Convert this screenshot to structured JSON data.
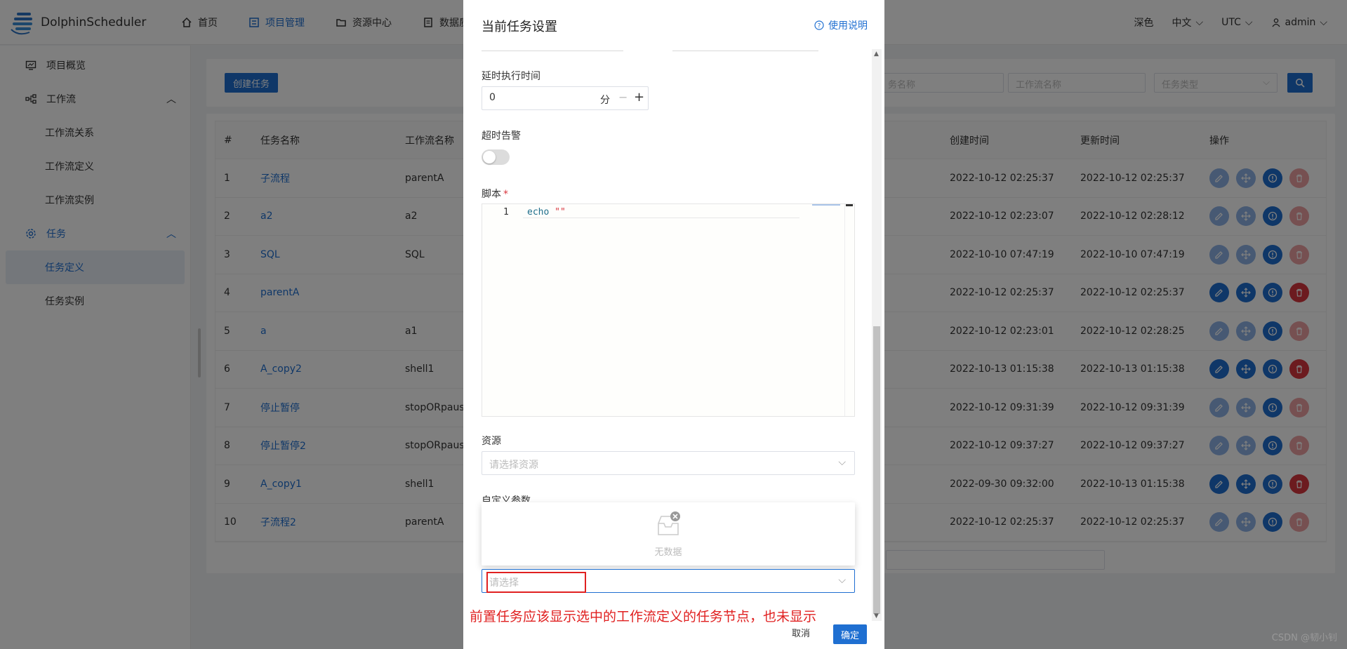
{
  "header": {
    "app_name": "DolphinScheduler",
    "nav": [
      {
        "label": "首页",
        "icon": "home-icon"
      },
      {
        "label": "项目管理",
        "icon": "project-icon"
      },
      {
        "label": "资源中心",
        "icon": "folder-icon"
      },
      {
        "label": "数据质量",
        "icon": "document-icon"
      }
    ],
    "theme": "深色",
    "language": "中文",
    "timezone": "UTC",
    "user": "admin"
  },
  "sidebar": {
    "items": [
      {
        "label": "项目概览",
        "icon": "monitor-icon"
      },
      {
        "label": "工作流",
        "icon": "workflow-icon"
      },
      {
        "label": "工作流关系"
      },
      {
        "label": "工作流定义"
      },
      {
        "label": "工作流实例"
      },
      {
        "label": "任务",
        "icon": "gear-icon"
      },
      {
        "label": "任务定义"
      },
      {
        "label": "任务实例"
      }
    ]
  },
  "toolbar": {
    "create_label": "创建任务",
    "filter_task_name": "务名称",
    "filter_workflow_name": "工作流名称",
    "filter_task_type": "任务类型"
  },
  "table": {
    "headers": {
      "idx": "#",
      "name": "任务名称",
      "workflow": "工作流名称",
      "created": "创建时间",
      "updated": "更新时间",
      "ops": "操作"
    },
    "rows": [
      {
        "idx": "1",
        "name": "子流程",
        "workflow": "parentA",
        "created": "2022-10-12 02:25:37",
        "updated": "2022-10-12 02:25:37"
      },
      {
        "idx": "2",
        "name": "a2",
        "workflow": "a2",
        "created": "2022-10-12 02:23:07",
        "updated": "2022-10-12 02:28:12"
      },
      {
        "idx": "3",
        "name": "SQL",
        "workflow": "SQL",
        "created": "2022-10-10 07:47:19",
        "updated": "2022-10-10 07:47:19"
      },
      {
        "idx": "4",
        "name": "parentA",
        "workflow": "",
        "created": "2022-10-12 02:25:37",
        "updated": "2022-10-12 02:25:37"
      },
      {
        "idx": "5",
        "name": "a",
        "workflow": "a1",
        "created": "2022-10-12 02:23:01",
        "updated": "2022-10-12 02:28:25"
      },
      {
        "idx": "6",
        "name": "A_copy2",
        "workflow": "shell1",
        "created": "2022-10-13 01:15:38",
        "updated": "2022-10-13 01:15:38"
      },
      {
        "idx": "7",
        "name": "停止暂停",
        "workflow": "stopORpause",
        "created": "2022-10-12 09:31:39",
        "updated": "2022-10-12 09:31:39"
      },
      {
        "idx": "8",
        "name": "停止暂停2",
        "workflow": "stopORpause",
        "created": "2022-10-12 09:37:27",
        "updated": "2022-10-12 09:37:27"
      },
      {
        "idx": "9",
        "name": "A_copy1",
        "workflow": "shell1",
        "created": "2022-09-30 09:32:00",
        "updated": "2022-10-13 01:15:38"
      },
      {
        "idx": "10",
        "name": "子流程2",
        "workflow": "parentA",
        "created": "2022-10-12 02:25:37",
        "updated": "2022-10-12 02:25:37"
      }
    ]
  },
  "drawer": {
    "title": "当前任务设置",
    "help": "使用说明",
    "delay_label": "延时执行时间",
    "delay_value": "0",
    "delay_unit": "分",
    "timeout_label": "超时告警",
    "script_label": "脚本",
    "script_line_no": "1",
    "script_kw": "echo",
    "script_str": "\"\"",
    "resource_label": "资源",
    "resource_placeholder": "请选择资源",
    "custom_param_label": "自定义参数",
    "empty_text": "无数据",
    "pre_task_placeholder": "请选择",
    "annotation": "前置任务应该显示选中的工作流定义的任务节点，也未显示",
    "cancel": "取消",
    "confirm": "确定"
  },
  "watermark": "CSDN @韧小钊"
}
